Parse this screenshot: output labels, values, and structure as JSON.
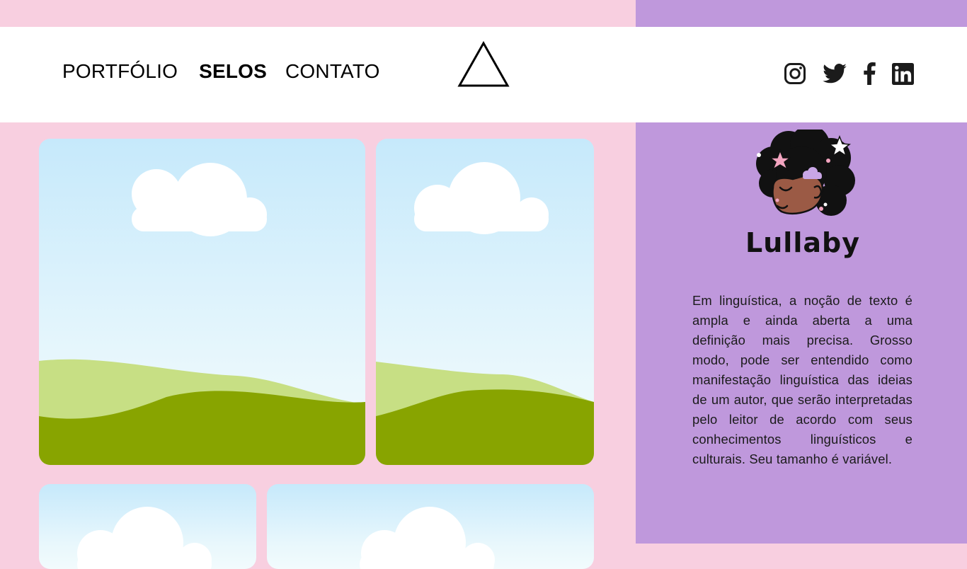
{
  "nav": {
    "portfolio_label": "PORTFÓLIO",
    "selos_label": "SELOS",
    "contato_label": "CONTATO"
  },
  "header": {
    "logo_icon": "triangle-outline-icon"
  },
  "social": [
    {
      "name": "instagram-icon"
    },
    {
      "name": "twitter-icon"
    },
    {
      "name": "facebook-icon"
    },
    {
      "name": "linkedin-icon"
    }
  ],
  "gallery": {
    "placeholder_icon": "landscape-placeholder"
  },
  "brand": {
    "name": "Lullaby",
    "description": "Em linguística, a noção de texto é ampla e ainda aberta a uma definição mais precisa. Grosso modo, pode ser entendido como manifestação linguística das ideias de um autor, que serão interpretadas pelo leitor de acordo com seus conhecimentos linguísticos e culturais. Seu tamanho é variável."
  },
  "colors": {
    "background_pink": "#f8cfe0",
    "sidebar_purple": "#bf98dc",
    "header_white": "#ffffff",
    "sky": "#c6e9fb",
    "hill_light": "#c7df84",
    "hill_dark": "#88a400"
  }
}
